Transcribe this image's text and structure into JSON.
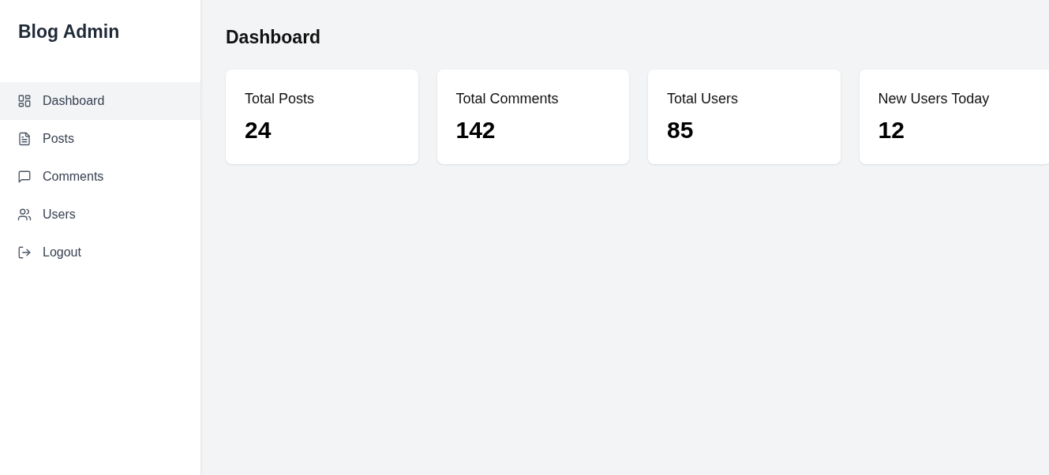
{
  "sidebar": {
    "title": "Blog Admin",
    "items": [
      {
        "label": "Dashboard",
        "kind": "dashboard",
        "selected": true
      },
      {
        "label": "Posts",
        "kind": "posts",
        "selected": false
      },
      {
        "label": "Comments",
        "kind": "comments",
        "selected": false
      },
      {
        "label": "Users",
        "kind": "users",
        "selected": false
      },
      {
        "label": "Logout",
        "kind": "logout",
        "selected": false
      }
    ]
  },
  "main": {
    "title": "Dashboard",
    "stats": [
      {
        "label": "Total Posts",
        "value": "24"
      },
      {
        "label": "Total Comments",
        "value": "142"
      },
      {
        "label": "Total Users",
        "value": "85"
      },
      {
        "label": "New Users Today",
        "value": "12"
      }
    ]
  }
}
